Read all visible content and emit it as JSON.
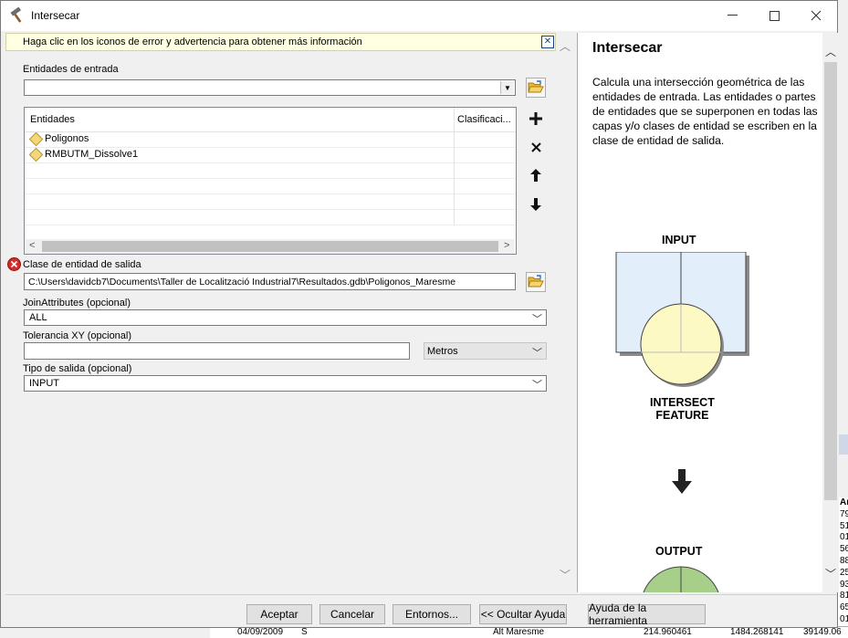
{
  "window": {
    "title": "Intersecar"
  },
  "warning": {
    "text": "Haga clic en los iconos de error y advertencia para obtener más información"
  },
  "input_features": {
    "label": "Entidades de entrada",
    "value": "",
    "table": {
      "col_features": "Entidades",
      "col_rank": "Clasificaci...",
      "rows": [
        {
          "name": "Poligonos"
        },
        {
          "name": "RMBUTM_Dissolve1"
        }
      ]
    }
  },
  "output": {
    "label": "Clase de entidad de salida",
    "value": "C:\\Users\\davidcb7\\Documents\\Taller de Localització Industrial7\\Resultados.gdb\\Poligonos_Maresme",
    "status": "error"
  },
  "join_attributes": {
    "label": "JoinAttributes (opcional)",
    "value": "ALL"
  },
  "xy_tolerance": {
    "label": "Tolerancia XY (opcional)",
    "value": "",
    "unit": "Metros"
  },
  "output_type": {
    "label": "Tipo de salida (opcional)",
    "value": "INPUT"
  },
  "buttons": {
    "ok": "Aceptar",
    "cancel": "Cancelar",
    "environments": "Entornos...",
    "hide_help": "<< Ocultar Ayuda",
    "tool_help": "Ayuda de la herramienta"
  },
  "help": {
    "title": "Intersecar",
    "description": "Calcula una intersección geométrica de las entidades de entrada. Las entidades o partes de entidades que se superponen en todas las capas y/o clases de entidad se escriben en la clase de entidad de salida.",
    "diagram": {
      "input_label": "INPUT",
      "intersect_label_1": "INTERSECT",
      "intersect_label_2": "FEATURE",
      "output_label": "OUTPUT"
    }
  },
  "background": {
    "grid_header": "Ar",
    "grid_values": [
      "79",
      "51",
      "01",
      "56",
      "88",
      "25",
      "93",
      "81",
      "65",
      "01"
    ],
    "bottom_row": [
      "04/09/2009",
      "S",
      "Alt Maresme",
      "214.960461",
      "1484.268141",
      "39149.06"
    ]
  },
  "colors": {
    "warning_bg": "#ffffe1",
    "input_fill": "#e3eefb",
    "intersect_fill": "#fdf9c4",
    "output_fill": "#a8cf8a"
  }
}
